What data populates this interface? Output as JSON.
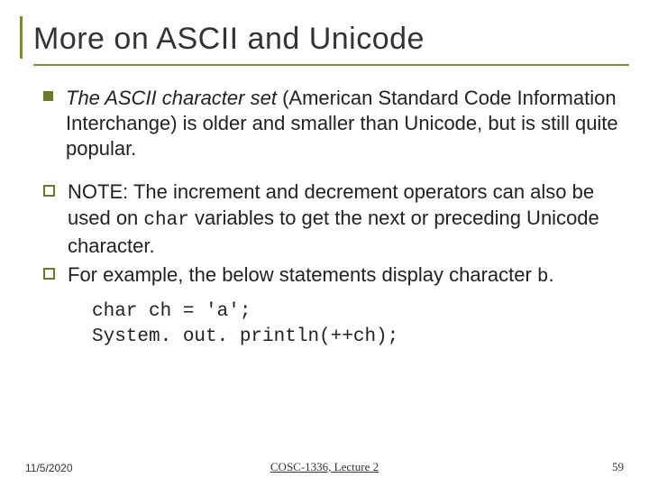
{
  "title": "More on ASCII and Unicode",
  "bullets": {
    "b1_italic": "The ASCII character set",
    "b1_rest": " (American Standard Code Information Interchange) is older and smaller than Unicode, but is still quite popular.",
    "b2_a": "NOTE: The increment and decrement operators can also be used on ",
    "b2_code": "char",
    "b2_b": " variables to get the next or preceding Unicode character.",
    "b3_a": " For example, the below statements display character ",
    "b3_code": "b",
    "b3_b": "."
  },
  "code": {
    "l1": "char ch = 'a';",
    "l2": "System. out. println(++ch);"
  },
  "footer": {
    "date": "11/5/2020",
    "course": "COSC-1336, Lecture 2",
    "page": "59"
  }
}
